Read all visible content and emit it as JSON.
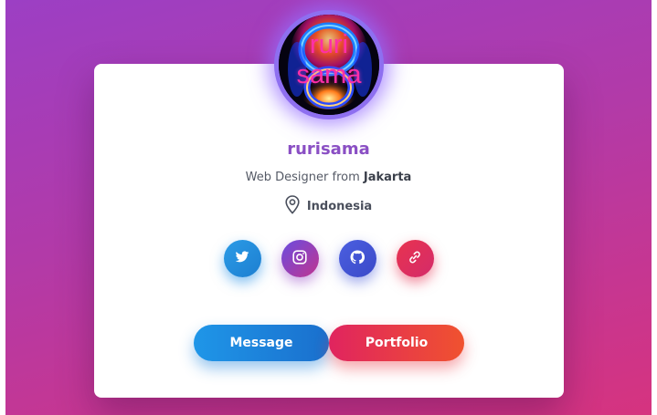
{
  "profile": {
    "avatar_text_line1": "ruri",
    "avatar_text_line2": "sama",
    "name": "rurisama",
    "role_prefix": "Web Designer from ",
    "role_city": "Jakarta",
    "location": "Indonesia"
  },
  "social": [
    {
      "icon": "twitter-icon",
      "color": "#1d8fe0"
    },
    {
      "icon": "instagram-icon",
      "color": "#a3409f"
    },
    {
      "icon": "github-icon",
      "color": "#4455d6"
    },
    {
      "icon": "link-icon",
      "color": "#e2304f"
    }
  ],
  "actions": {
    "message_label": "Message",
    "portfolio_label": "Portfolio"
  },
  "colors": {
    "background_start": "#9c3fc4",
    "background_end": "#d6337f",
    "name": "#8a4fc4",
    "avatar_ring": "#8e6ff0"
  }
}
